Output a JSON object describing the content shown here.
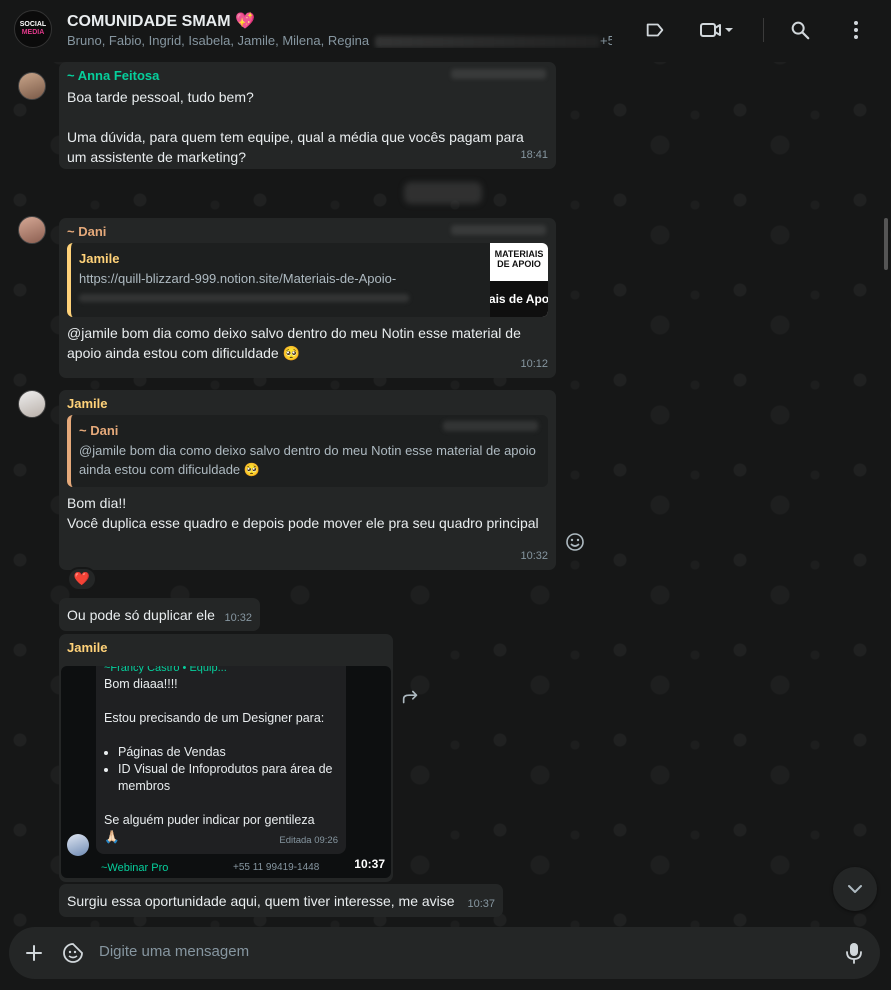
{
  "header": {
    "avatar_line1": "SOCIAL",
    "avatar_line2": "MEDIA",
    "title": "COMUNIDADE SMAM 💖",
    "members": "Bruno, Fabio, Ingrid, Isabela, Jamile, Milena, Regina",
    "members_tail": "+5..."
  },
  "messages": [
    {
      "sender": "~ Anna Feitosa",
      "text_line1": "Boa tarde pessoal, tudo bem?",
      "text_line2": "Uma dúvida, para quem tem equipe, qual a média que vocês pagam para",
      "text_line3": "um assistente de marketing?",
      "time": "18:41"
    },
    {
      "sender": "~ Dani",
      "link_title": "Jamile",
      "link_url": "https://quill-blizzard-999.notion.site/Materiais-de-Apoio-",
      "link_thumb_top": "MATERIAIS DE APOIO",
      "link_thumb_bottom": "ais de Apo",
      "text_line1": "@jamile bom dia como deixo salvo dentro do meu Notin esse material de",
      "text_line2": "apoio ainda estou com dificuldade 🥺",
      "time": "10:12"
    },
    {
      "sender": "Jamile",
      "quote_name": "~ Dani",
      "quote_line1": "@jamile bom dia como deixo salvo dentro do meu Notin esse material de apoio",
      "quote_line2": "ainda estou com dificuldade 🥺",
      "text_line1": "Bom dia!!",
      "text_line2": "Você duplica esse quadro e depois pode mover ele pra seu quadro principal",
      "time": "10:32",
      "reaction": "❤️"
    },
    {
      "text": "Ou pode só duplicar ele",
      "time": "10:32"
    },
    {
      "sender": "Jamile",
      "image": {
        "top_cut": "~Francy Castro • Equip...",
        "line1": "Bom diaaa!!!!",
        "line2": "Estou precisando de um Designer para:",
        "bullet1": "Páginas de Vendas",
        "bullet2": "ID Visual de Infoprodutos para área de membros",
        "line3": "Se alguém puder indicar por gentileza",
        "line4": "🙏🏻",
        "edited": "Editada 09:26",
        "webinar": "~Webinar Pro",
        "phone": "+55 11 99419-1448"
      },
      "time": "10:37"
    },
    {
      "text": "Surgiu essa oportunidade aqui, quem tiver interesse, me avise",
      "time": "10:37"
    }
  ],
  "composer": {
    "placeholder": "Digite uma mensagem"
  },
  "colors": {
    "background": "#161717",
    "bubble": "#242626",
    "accent_green": "#06cf9c",
    "sender_orange": "#e5a97a",
    "sender_yellow": "#ffd279"
  }
}
